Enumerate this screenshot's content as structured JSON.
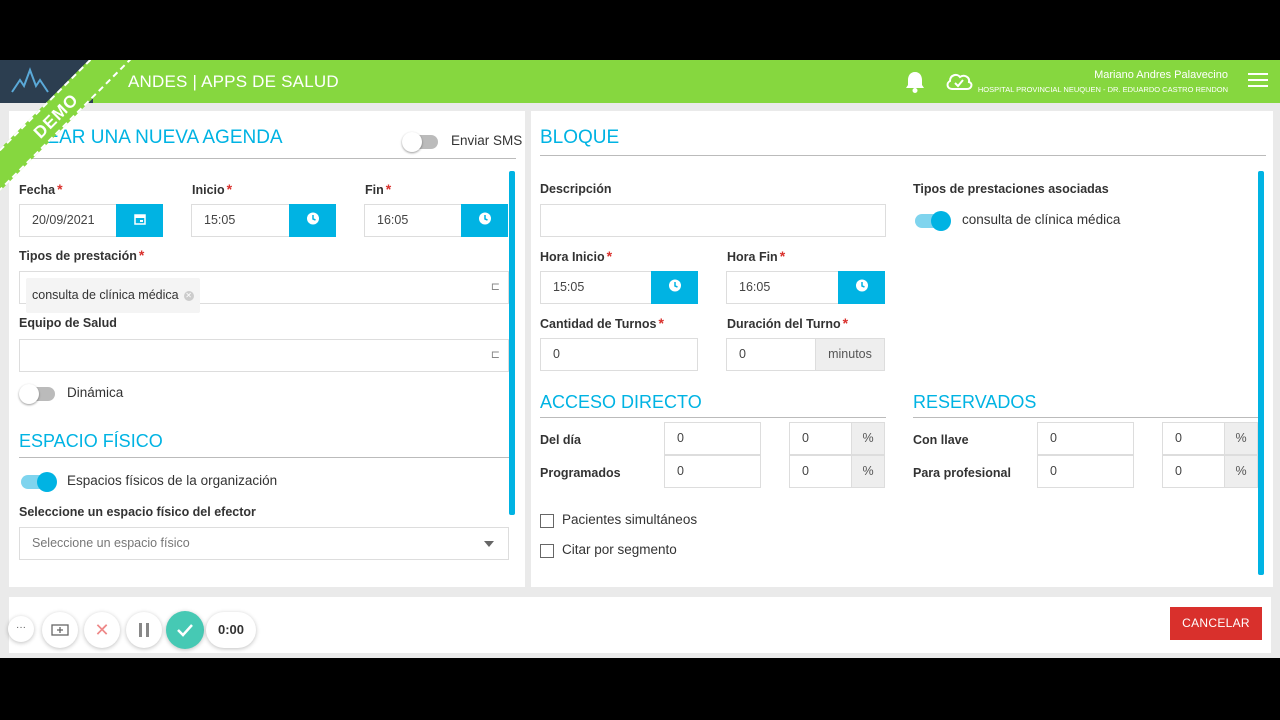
{
  "app": {
    "title": "ANDES | APPS DE SALUD",
    "demo_label": "DEMO"
  },
  "user": {
    "name": "Mariano Andres Palavecino",
    "hospital": "HOSPITAL PROVINCIAL NEUQUEN - DR. EDUARDO CASTRO RENDON"
  },
  "colors": {
    "topbar": "#86d73f",
    "accent": "#00b3e3",
    "danger": "#d9302c"
  },
  "agenda": {
    "title": "CREAR UNA NUEVA AGENDA",
    "sms_label": "Enviar SMS",
    "fecha_label": "Fecha",
    "fecha_value": "20/09/2021",
    "inicio_label": "Inicio",
    "inicio_value": "15:05",
    "fin_label": "Fin",
    "fin_value": "16:05",
    "prestacion_label": "Tipos de prestación",
    "prestacion_chip": "consulta de clínica médica",
    "equipo_label": "Equipo de Salud",
    "dinamica_label": "Dinámica",
    "espacio_title": "ESPACIO FÍSICO",
    "espacios_toggle_label": "Espacios físicos de la organización",
    "select_espacio_label": "Seleccione un espacio físico del efector",
    "select_espacio_placeholder": "Seleccione un espacio físico"
  },
  "bloque": {
    "title": "BLOQUE",
    "descripcion_label": "Descripción",
    "descripcion_value": "",
    "tipos_asociadas_label": "Tipos de prestaciones asociadas",
    "tipo_asociada_item": "consulta de clínica médica",
    "hora_inicio_label": "Hora Inicio",
    "hora_inicio_value": "15:05",
    "hora_fin_label": "Hora Fin",
    "hora_fin_value": "16:05",
    "cantidad_label": "Cantidad de Turnos",
    "cantidad_value": "0",
    "duracion_label": "Duración del Turno",
    "duracion_value": "0",
    "duracion_unit": "minutos"
  },
  "acceso": {
    "title": "ACCESO DIRECTO",
    "rows": [
      {
        "label": "Del día",
        "value": "0",
        "pct": "0",
        "pct_sym": "%"
      },
      {
        "label": "Programados",
        "value": "0",
        "pct": "0",
        "pct_sym": "%"
      }
    ]
  },
  "reservados": {
    "title": "RESERVADOS",
    "rows": [
      {
        "label": "Con llave",
        "value": "0",
        "pct": "0",
        "pct_sym": "%"
      },
      {
        "label": "Para profesional",
        "value": "0",
        "pct": "0",
        "pct_sym": "%"
      }
    ]
  },
  "options": {
    "simultaneos": "Pacientes simultáneos",
    "segmento": "Citar por segmento"
  },
  "footer": {
    "cancel": "CANCELAR",
    "timer": "0:00",
    "more": "···"
  },
  "icons": [
    "logo-icon",
    "bell-icon",
    "cloud-check-icon",
    "hamburger-icon",
    "calendar-icon",
    "clock-icon",
    "dropdown-arrow-icon",
    "add-video-icon",
    "close-icon",
    "pause-icon",
    "check-icon"
  ]
}
